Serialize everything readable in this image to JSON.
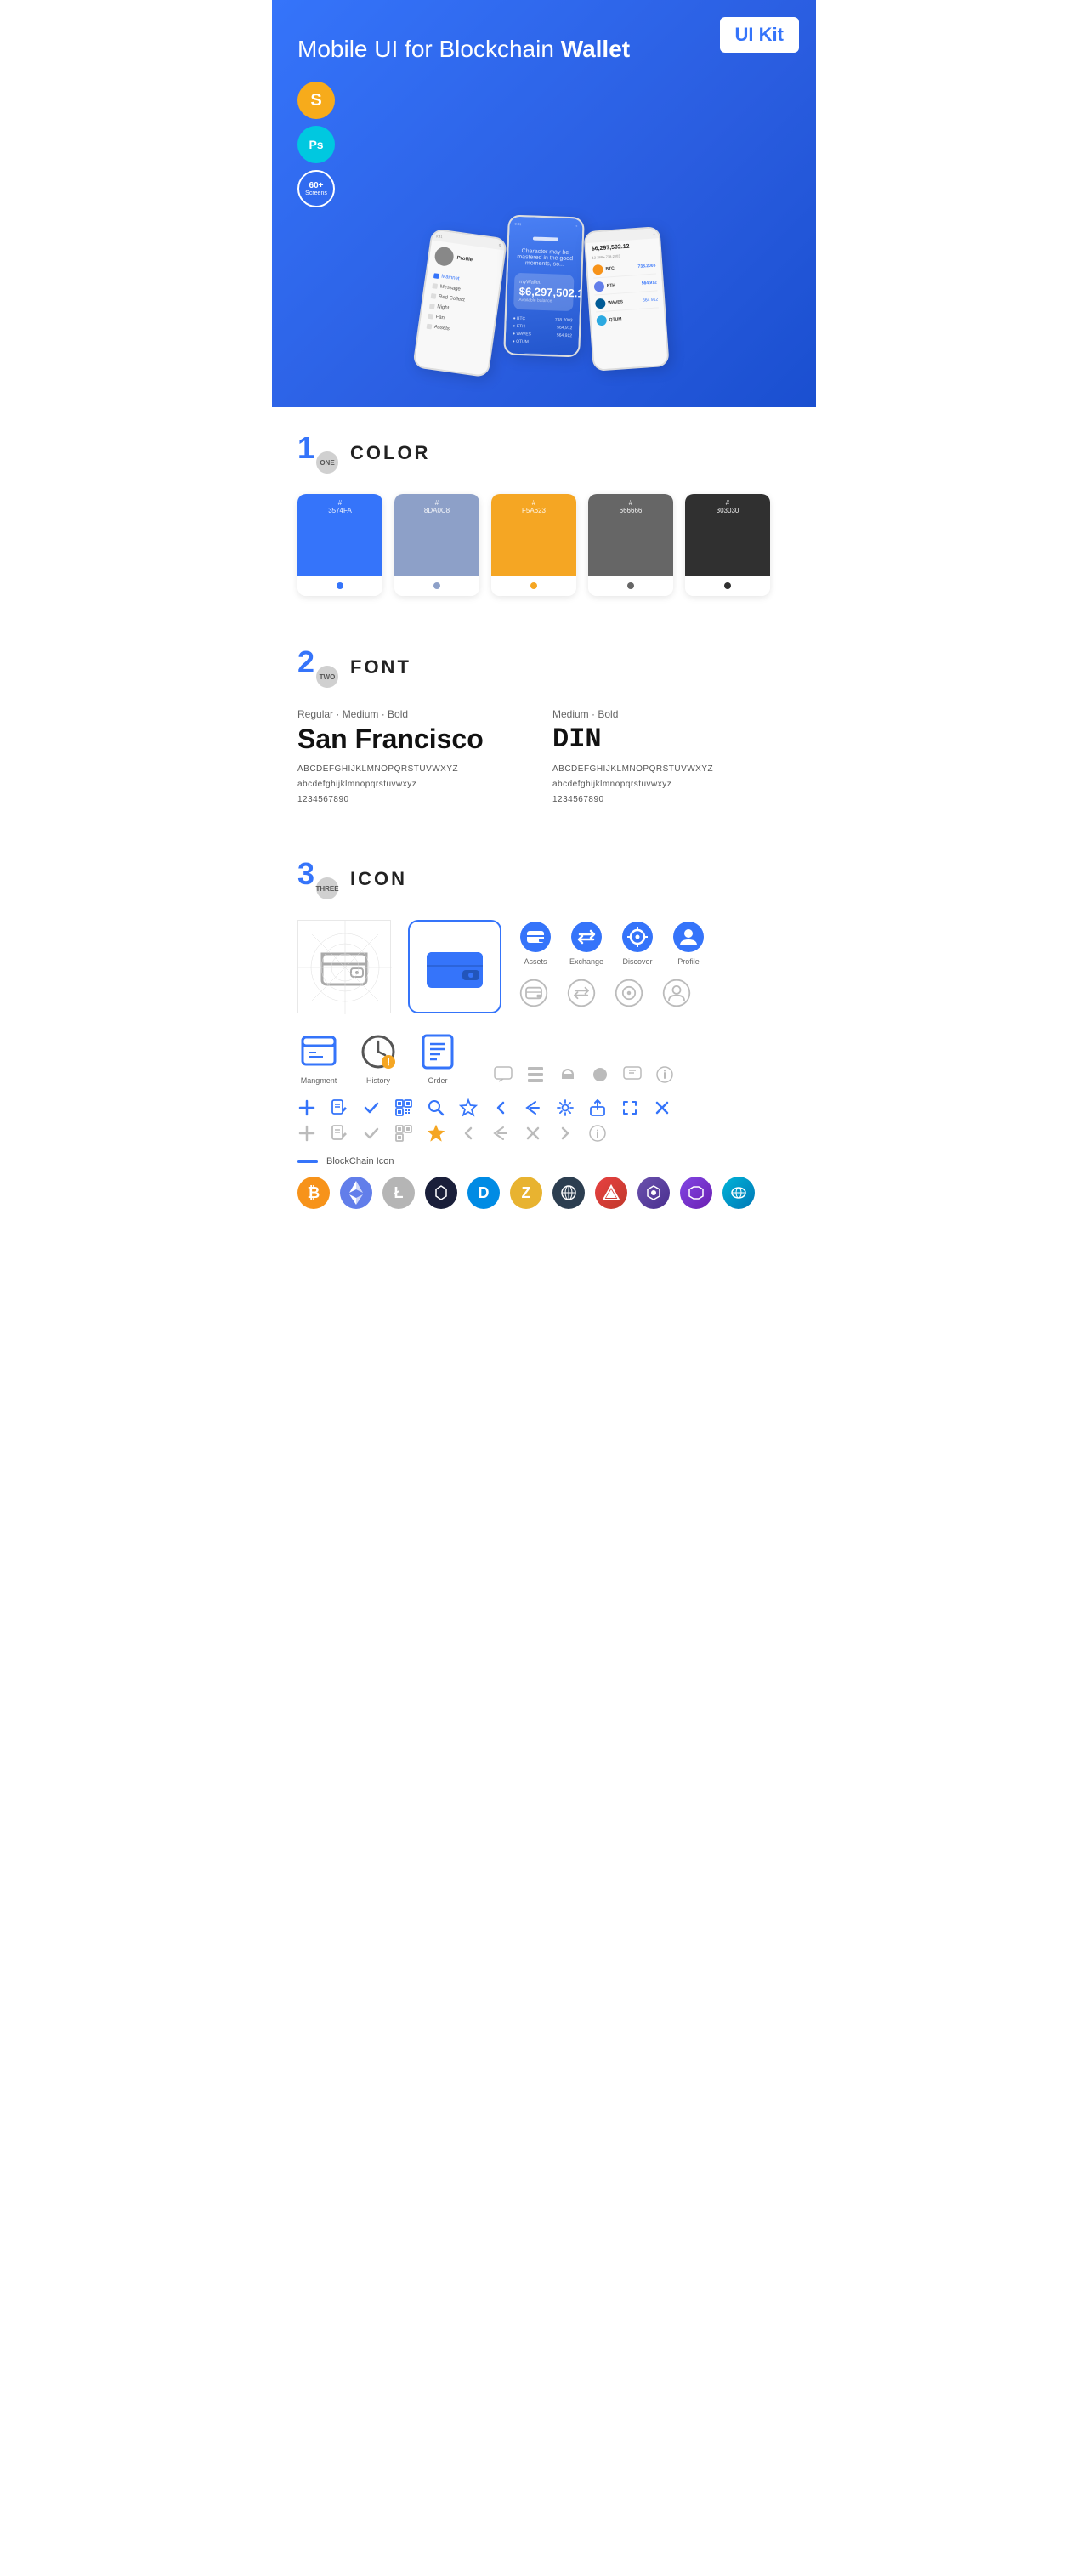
{
  "hero": {
    "title_normal": "Mobile UI for Blockchain ",
    "title_bold": "Wallet",
    "badge": "UI Kit",
    "badges": [
      {
        "id": "sketch",
        "label": "S",
        "title": "Sketch"
      },
      {
        "id": "ps",
        "label": "Ps",
        "title": "Photoshop"
      },
      {
        "id": "screens",
        "label": "60+\nScreens",
        "title": "60+ Screens"
      }
    ]
  },
  "sections": {
    "color": {
      "number": "1",
      "number_sub": "ONE",
      "title": "COLOR",
      "swatches": [
        {
          "hex": "#3574FA",
          "code": "#\n3574FA",
          "dot": "#fff"
        },
        {
          "hex": "#8DA0C8",
          "code": "#\n8DA0C8",
          "dot": "#fff"
        },
        {
          "hex": "#F5A623",
          "code": "#\nF5A623",
          "dot": "#fff"
        },
        {
          "hex": "#666666",
          "code": "#\n666666",
          "dot": "#fff"
        },
        {
          "hex": "#303030",
          "code": "#\n303030",
          "dot": "#fff"
        }
      ]
    },
    "font": {
      "number": "2",
      "number_sub": "TWO",
      "title": "FONT",
      "fonts": [
        {
          "style": "Regular · Medium · Bold",
          "name": "San Francisco",
          "uppercase": "ABCDEFGHIJKLMNOPQRSTUVWXYZ",
          "lowercase": "abcdefghijklmnopqrstuvwxyz",
          "numbers": "1234567890"
        },
        {
          "style": "Medium · Bold",
          "name": "DIN",
          "uppercase": "ABCDEFGHIJKLMNOPQRSTUVWXYZ",
          "lowercase": "abcdefghijklmnopqrstuvwxyz",
          "numbers": "1234567890"
        }
      ]
    },
    "icon": {
      "number": "3",
      "number_sub": "THREE",
      "title": "ICON",
      "nav_icons": [
        {
          "label": "Assets",
          "color": "#3574FA"
        },
        {
          "label": "Exchange",
          "color": "#3574FA"
        },
        {
          "label": "Discover",
          "color": "#3574FA"
        },
        {
          "label": "Profile",
          "color": "#3574FA"
        }
      ],
      "app_icons": [
        {
          "label": "Mangment"
        },
        {
          "label": "History"
        },
        {
          "label": "Order"
        }
      ],
      "blockchain_label": "BlockChain Icon",
      "crypto": [
        {
          "symbol": "₿",
          "color": "#f7931a",
          "name": "Bitcoin"
        },
        {
          "symbol": "Ξ",
          "color": "#627eea",
          "name": "Ethereum"
        },
        {
          "symbol": "Ł",
          "color": "#cccccc",
          "name": "Litecoin"
        },
        {
          "symbol": "◆",
          "color": "#1a1a2e",
          "name": "BitShares"
        },
        {
          "symbol": "D",
          "color": "#008ce7",
          "name": "Dash"
        },
        {
          "symbol": "Z",
          "color": "#e8b130",
          "name": "Zcash"
        },
        {
          "symbol": "◈",
          "color": "#444",
          "name": "Grid"
        },
        {
          "symbol": "▲",
          "color": "#e84142",
          "name": "Avalanche"
        },
        {
          "symbol": "◈",
          "color": "#6b52ae",
          "name": "Augur"
        },
        {
          "symbol": "◇",
          "color": "#e91e8c",
          "name": "Waves"
        },
        {
          "symbol": "●",
          "color": "#3574FA",
          "name": "Other"
        }
      ]
    }
  }
}
